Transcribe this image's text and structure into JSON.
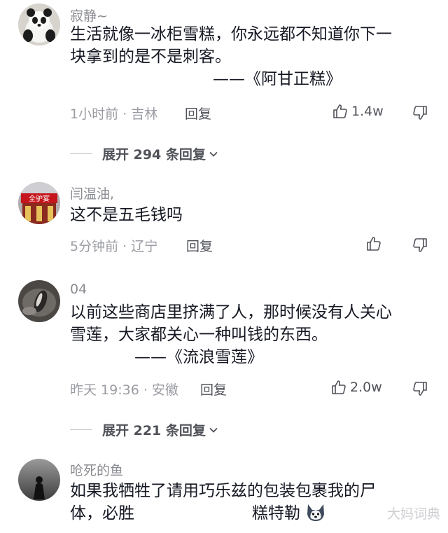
{
  "comments": [
    {
      "username": "寂静~",
      "lines": [
        "生活就像一冰柜雪糕，你永远都不知道你下一",
        "块拿到的是不是刺客。",
        "——《阿甘正糕》"
      ],
      "time_location": "1小时前 · 吉林",
      "reply_label": "回复",
      "likes": "1.4w",
      "expand_label": "展开 294 条回复"
    },
    {
      "username": "闫温油,",
      "avatar_sign": "全驴宴",
      "lines": [
        "这不是五毛钱吗"
      ],
      "time_location": "5分钟前 · 辽宁",
      "reply_label": "回复",
      "likes": ""
    },
    {
      "username": "04",
      "lines": [
        "以前这些商店里挤满了人，那时候没有人关心",
        "雪莲，大家都关心一种叫钱的东西。",
        "——《流浪雪莲》"
      ],
      "time_location": "昨天 19:36 · 安徽",
      "reply_label": "回复",
      "likes": "2.0w",
      "expand_label": "展开 221 条回复"
    },
    {
      "username": "呛死的鱼",
      "lines": [
        "如果我牺牲了请用巧乐兹的包装包裹我的尸",
        "体，必胜",
        "糕特勒"
      ]
    }
  ],
  "watermark": "大妈词典",
  "icons": {
    "like": "thumbs-up-icon",
    "dislike": "thumbs-down-icon",
    "expand": "chevron-down-icon",
    "emoji": "husky-dog-emoji"
  }
}
